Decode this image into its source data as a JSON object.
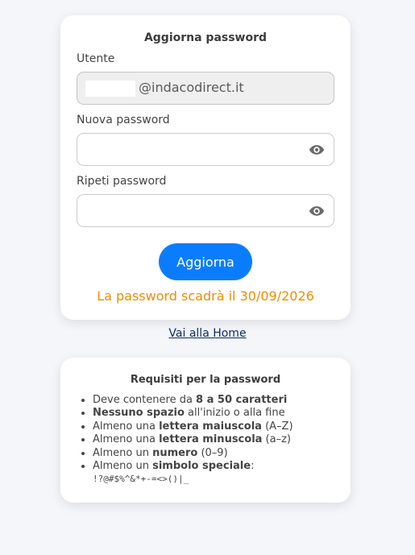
{
  "form": {
    "title": "Aggiorna password",
    "user_label": "Utente",
    "user_domain": "@indacodirect.it",
    "new_password_label": "Nuova password",
    "repeat_password_label": "Ripeti password",
    "submit_label": "Aggiorna",
    "expiry_text": "La password scadrà il 30/09/2026",
    "accent_color": "#0a7dff",
    "expiry_color": "#f28c00"
  },
  "home_link": "Vai alla Home",
  "requirements": {
    "title": "Requisiti per la password",
    "items": [
      {
        "pre": "Deve contenere da ",
        "bold": "8 a 50 caratteri",
        "post": ""
      },
      {
        "pre": "",
        "bold": "Nessuno spazio",
        "post": " all'inizio o alla fine"
      },
      {
        "pre": "Almeno una ",
        "bold": "lettera maiuscola",
        "post": " (A–Z)"
      },
      {
        "pre": "Almeno una ",
        "bold": "lettera minuscola",
        "post": " (a–z)"
      },
      {
        "pre": "Almeno un ",
        "bold": "numero",
        "post": " (0–9)"
      },
      {
        "pre": "Almeno un ",
        "bold": "simbolo speciale",
        "post": ":"
      }
    ],
    "symbols": "!?@#$%^&*+-=<>()|_"
  }
}
